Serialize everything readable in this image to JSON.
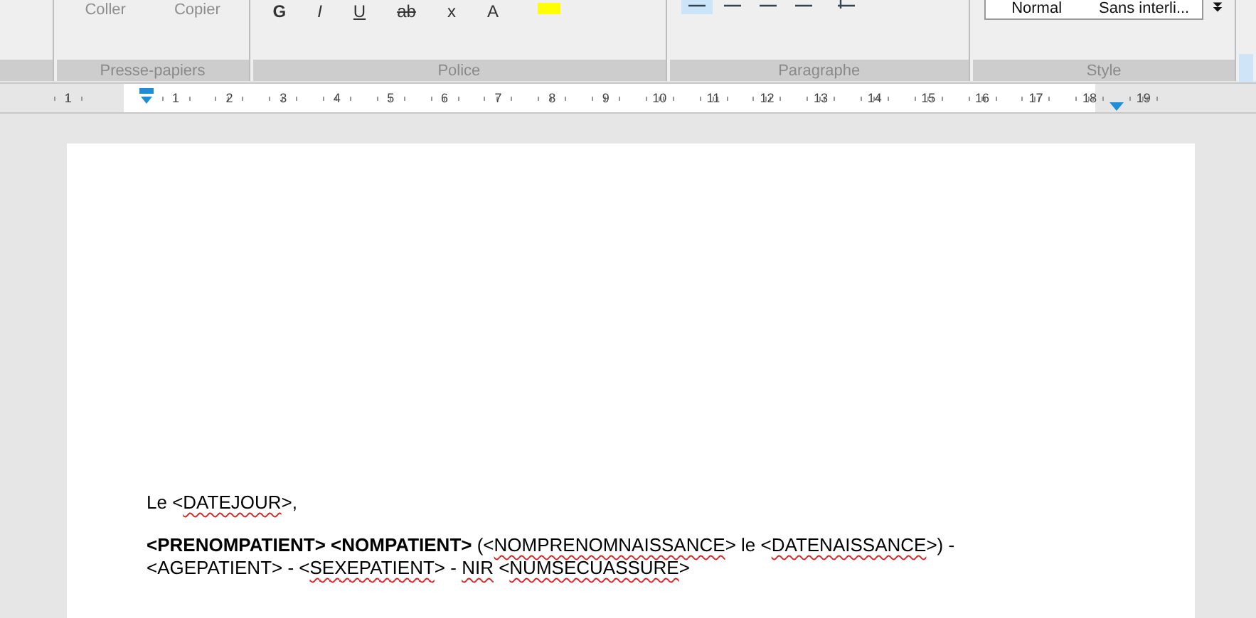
{
  "ribbon": {
    "groups": [
      {
        "kind": "stub"
      },
      {
        "kind": "clipboard",
        "label": "Presse-papiers",
        "buttons": [
          "Coller",
          "Copier"
        ]
      },
      {
        "kind": "font",
        "label": "Police",
        "tools": [
          "G",
          "I",
          "U",
          "ab",
          "x",
          "A"
        ]
      },
      {
        "kind": "paragraph",
        "label": "Paragraphe"
      },
      {
        "kind": "style",
        "label": "Style",
        "styles": [
          "Normal",
          "Sans interli..."
        ]
      }
    ]
  },
  "ruler": {
    "before": [
      "1"
    ],
    "after": [
      "1",
      "2",
      "3",
      "4",
      "5",
      "6",
      "7",
      "8",
      "9",
      "10",
      "11",
      "12",
      "13",
      "14",
      "15",
      "16",
      "17",
      "18",
      "19"
    ]
  },
  "document": {
    "paragraphs": [
      [
        {
          "text": "Le <"
        },
        {
          "text": "DATEJOUR",
          "spellcheck": true
        },
        {
          "text": ">,"
        }
      ],
      [
        {
          "text": "<PRENOMPATIENT> <NOMPATIENT>",
          "bold": true
        },
        {
          "text": " (<"
        },
        {
          "text": "NOMPRENOMNAISSANCE",
          "spellcheck": true
        },
        {
          "text": "> le <"
        },
        {
          "text": "DATENAISSANCE",
          "spellcheck": true
        },
        {
          "text": ">) - <AGEPATIENT> - <"
        },
        {
          "text": "SEXEPATIENT",
          "spellcheck": true
        },
        {
          "text": "> - "
        },
        {
          "text": "NIR",
          "spellcheck": true
        },
        {
          "text": " <"
        },
        {
          "text": "NUMSECUASSURE",
          "spellcheck": true
        },
        {
          "text": ">"
        }
      ]
    ]
  }
}
